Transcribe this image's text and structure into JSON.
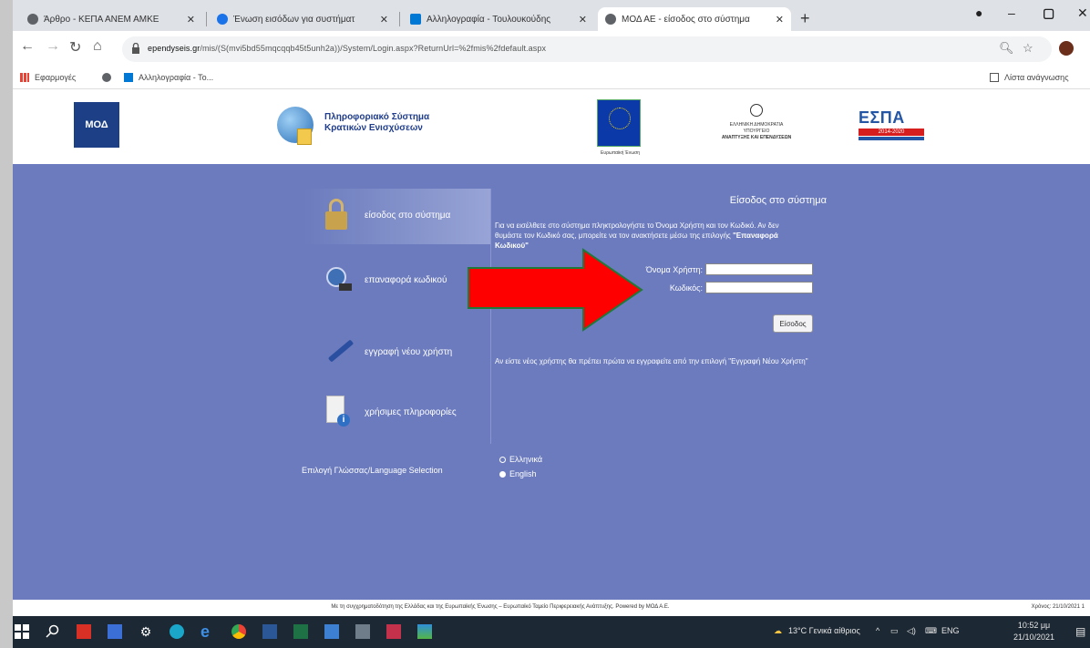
{
  "browser": {
    "tabs": [
      {
        "title": "Άρθρο - ΚΕΠΑ ΑΝΕΜ ΑΜΚΕ",
        "favicon_color": "#5f6368"
      },
      {
        "title": "Ένωση εισόδων για συστήματ",
        "favicon_color": "#1a73e8"
      },
      {
        "title": "Αλληλογραφία - Τουλουκούδης",
        "favicon_color": "#0078d4"
      },
      {
        "title": "ΜΟΔ ΑΕ - είσοδος στο σύστημα",
        "favicon_color": "#5f6368",
        "active": true
      }
    ],
    "url_host": "ependyseis.gr",
    "url_path": "/mis/(S(mvi5bd55mqcqqb45t5unh2a))/System/Login.aspx?ReturnUrl=%2fmis%2fdefault.aspx",
    "bookmarks": [
      {
        "label": "Εφαρμογές"
      },
      {
        "label": ""
      },
      {
        "label": "Αλληλογραφία - Το..."
      }
    ],
    "reading_list": "Λίστα ανάγνωσης"
  },
  "header": {
    "moda_logo_text": "ΜΟΔ",
    "system_title_line1": "Πληροφοριακό Σύστημα",
    "system_title_line2": "Κρατικών Ενισχύσεων",
    "eu_caption": "Ευρωπαϊκή Ένωση",
    "ministry_line1": "ΕΛΛΗΝΙΚΗ ΔΗΜΟΚΡΑΤΙΑ",
    "ministry_line2": "ΥΠΟΥΡΓΕΙΟ",
    "ministry_line3": "ΑΝΑΠΤΥΞΗΣ ΚΑΙ ΕΠΕΝΔΥΣΕΩΝ",
    "espa_text": "ΕΣΠΑ",
    "espa_years": "2014-2020"
  },
  "menu": {
    "login": "είσοδος στο σύστημα",
    "reset": "επαναφορά κωδικού",
    "register": "εγγραφή νέου χρήστη",
    "info": "χρήσιμες πληροφορίες"
  },
  "login": {
    "title": "Είσοδος στο σύστημα",
    "instructions": "Για να εισέλθετε στο σύστημα πληκτρολογήστε το Όνομα Χρήστη και τον Κωδικό. Αν δεν θυμάστε τον Κωδικό σας, μπορείτε να τον ανακτήσετε μέσω της επιλογής",
    "reset_link": "\"Επαναφορά Κωδικού\"",
    "username_label": "Όνομα Χρήστη:",
    "password_label": "Κωδικός:",
    "username_value": "",
    "password_value": "",
    "button_label": "Είσοδος",
    "new_user_text": "Αν είστε νέος χρήστης θα πρέπει πρώτα να εγγραφείτε από την επιλογή \"Εγγραφή Νέου Χρήστη\""
  },
  "language": {
    "label": "Επιλογή Γλώσσας/Language Selection",
    "options": [
      "Ελληνικά",
      "English"
    ],
    "selected": "English"
  },
  "footer": {
    "text": "Με τη συγχρηματοδότηση της Ελλάδας και της Ευρωπαϊκής Ένωσης – Ευρωπαϊκό Ταμείο Περιφερειακής Ανάπτυξης. Powered by ΜΟΔ Α.Ε.",
    "date": "Χρόνος: 21/10/2021 1"
  },
  "taskbar": {
    "weather": "13°C Γενικά αίθριος",
    "language": "ΕΝG",
    "time": "10:52 μμ",
    "date": "21/10/2021"
  },
  "colors": {
    "page_blue": "#6b7bbd",
    "arrow_red": "#ff0000",
    "arrow_outline": "#1f7a3a"
  }
}
